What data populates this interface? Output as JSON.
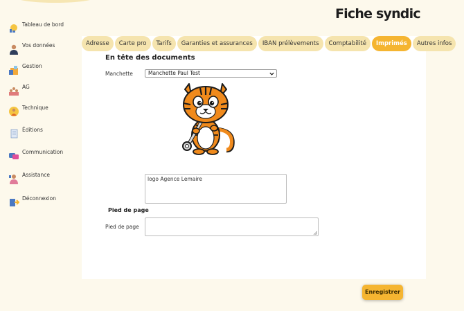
{
  "page": {
    "title": "Fiche syndic"
  },
  "sidebar": {
    "items": [
      {
        "label": "Tableau de bord",
        "icon": "lightbulb-icon"
      },
      {
        "label": "Vos données",
        "icon": "user-icon"
      },
      {
        "label": "Gestion",
        "icon": "management-icon"
      },
      {
        "label": "AG",
        "icon": "meeting-icon"
      },
      {
        "label": "Technique",
        "icon": "technician-icon"
      },
      {
        "label": "Éditions",
        "icon": "document-icon"
      },
      {
        "label": "Communication",
        "icon": "chat-icon"
      },
      {
        "label": "Assistance",
        "icon": "support-icon"
      },
      {
        "label": "Déconnexion",
        "icon": "logout-icon"
      }
    ]
  },
  "tabs": [
    {
      "label": "Adresse",
      "active": false
    },
    {
      "label": "Carte pro",
      "active": false
    },
    {
      "label": "Tarifs",
      "active": false
    },
    {
      "label": "Garanties et assurances",
      "active": false
    },
    {
      "label": "IBAN prélèvements",
      "active": false
    },
    {
      "label": "Comptabilité",
      "active": false
    },
    {
      "label": "Imprimés",
      "active": true
    },
    {
      "label": "Autres infos",
      "active": false
    }
  ],
  "header_section": {
    "title": "En tête des documents",
    "manchette_label": "Manchette",
    "manchette_value": "Manchette Paul Test",
    "logo_text": "logo Agence Lemaire"
  },
  "footer_section": {
    "title": "Pied de page",
    "label": "Pied de page",
    "value": ""
  },
  "actions": {
    "save_label": "Enregistrer"
  },
  "colors": {
    "accent": "#f5b531",
    "tab_bg": "#f5e4ae",
    "page_bg": "#fdf9ec"
  }
}
